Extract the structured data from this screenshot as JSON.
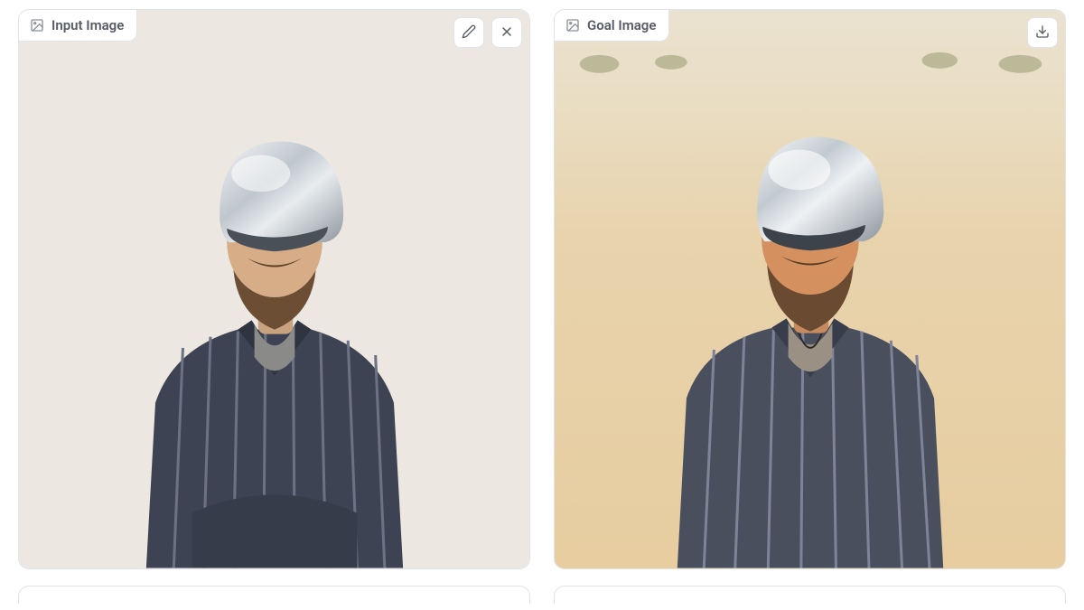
{
  "panels": {
    "input": {
      "label": "Input Image"
    },
    "goal": {
      "label": "Goal Image"
    }
  },
  "icons": {
    "image": "image-icon",
    "edit": "pencil-icon",
    "close": "close-icon",
    "download": "download-icon"
  }
}
